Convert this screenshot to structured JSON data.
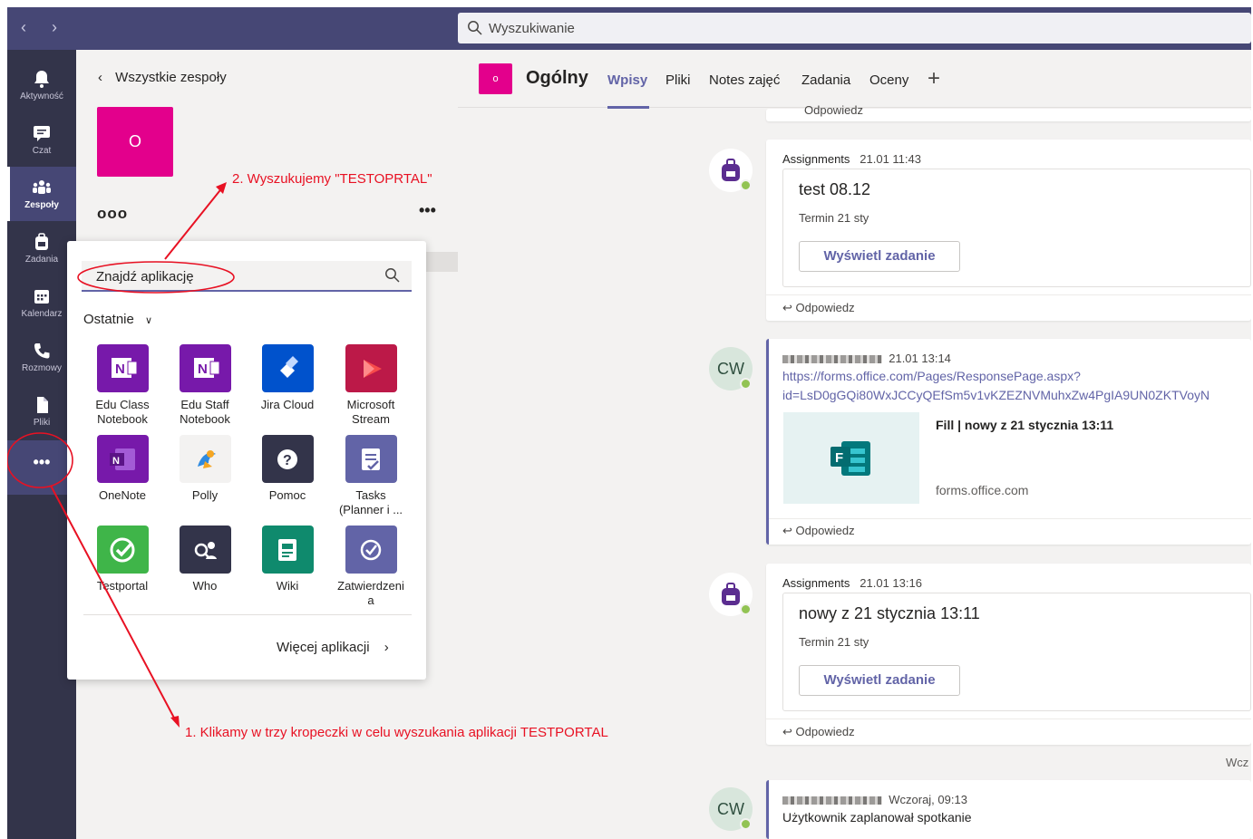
{
  "topbar": {
    "search_placeholder": "Wyszukiwanie",
    "back_icon": "chevron-left-icon",
    "forward_icon": "chevron-right-icon"
  },
  "rail": {
    "items": [
      {
        "label": "Aktywność",
        "icon": "bell-icon"
      },
      {
        "label": "Czat",
        "icon": "chat-icon"
      },
      {
        "label": "Zespoły",
        "icon": "teams-icon"
      },
      {
        "label": "Zadania",
        "icon": "assignments-icon"
      },
      {
        "label": "Kalendarz",
        "icon": "calendar-icon"
      },
      {
        "label": "Rozmowy",
        "icon": "phone-icon"
      },
      {
        "label": "Pliki",
        "icon": "files-icon"
      }
    ],
    "more": "•••"
  },
  "teampanel": {
    "back_label": "Wszystkie zespoły",
    "tile_letter": "O",
    "team_name": "ooo",
    "more": "•••"
  },
  "annotations": {
    "step2": "2. Wyszukujemy \"TESTOPRTAL\"",
    "step1": "1. Klikamy w trzy kropeczki w celu wyszukania aplikacji TESTPORTAL"
  },
  "popup": {
    "search_placeholder": "Znajdź aplikację",
    "section": "Ostatnie",
    "apps": [
      {
        "name": "Edu Class\nNotebook",
        "color": "#7719aa",
        "icon": "onenote-class-icon"
      },
      {
        "name": "Edu Staff\nNotebook",
        "color": "#7719aa",
        "icon": "onenote-staff-icon"
      },
      {
        "name": "Jira Cloud",
        "color": "#0052cc",
        "icon": "jira-icon"
      },
      {
        "name": "Microsoft\nStream",
        "color": "#bc1948",
        "icon": "stream-icon"
      },
      {
        "name": "OneNote",
        "color": "#7719aa",
        "icon": "onenote-icon"
      },
      {
        "name": "Polly",
        "color": "#f3f2f1",
        "icon": "polly-icon"
      },
      {
        "name": "Pomoc",
        "color": "#33344a",
        "icon": "help-icon"
      },
      {
        "name": "Tasks\n(Planner i ...",
        "color": "#6264a7",
        "icon": "tasks-icon"
      },
      {
        "name": "Testportal",
        "color": "#3fb549",
        "icon": "testportal-icon"
      },
      {
        "name": "Who",
        "color": "#33344a",
        "icon": "who-icon"
      },
      {
        "name": "Wiki",
        "color": "#0f8a6d",
        "icon": "wiki-icon"
      },
      {
        "name": "Zatwierdzeni\na",
        "color": "#6264a7",
        "icon": "approvals-icon"
      }
    ],
    "more_apps": "Więcej aplikacji"
  },
  "channel": {
    "tile_letter": "o",
    "name": "Ogólny",
    "tabs": [
      "Wpisy",
      "Pliki",
      "Notes zajęć",
      "Zadania",
      "Oceny"
    ],
    "active_tab": "Wpisy"
  },
  "posts": [
    {
      "author": "Assignments",
      "time": "21.01 11:43",
      "title": "test 08.12",
      "due": "Termin 21 sty",
      "button": "Wyświetl zadanie",
      "reply": "Odpowiedz"
    },
    {
      "author_initials": "CW",
      "time": "21.01 13:14",
      "link1": "https://forms.office.com/Pages/ResponsePage.aspx?",
      "link2": "id=LsD0gGQi80WxJCCyQEfSm5v1vKZEZNVMuhxZw4PgIA9UN0ZKTVoyN",
      "preview_title": "Fill | nowy z 21 stycznia 13:11",
      "preview_domain": "forms.office.com",
      "reply": "Odpowiedz"
    },
    {
      "author": "Assignments",
      "time": "21.01 13:16",
      "title": "nowy z 21 stycznia 13:11",
      "due": "Termin 21 sty",
      "button": "Wyświetl zadanie",
      "reply": "Odpowiedz"
    },
    {
      "author_initials": "CW",
      "time": "Wczoraj, 09:13",
      "text": "Użytkownik zaplanował spotkanie"
    }
  ],
  "top_reply_fragment": "Odpowiedz",
  "divider_label": "Wcz",
  "colors": {
    "brand": "#6264a7",
    "rail": "#33344a",
    "topbar": "#464775",
    "team": "#e3008c",
    "annotation": "#e81123"
  }
}
